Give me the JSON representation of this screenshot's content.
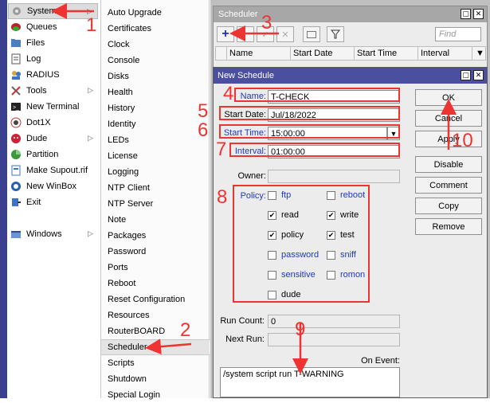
{
  "left_menu": {
    "items": [
      {
        "label": "System",
        "icon": "gear-icon",
        "submenu": true,
        "active": true
      },
      {
        "label": "Queues",
        "icon": "queues-icon",
        "submenu": false
      },
      {
        "label": "Files",
        "icon": "folder-icon",
        "submenu": false
      },
      {
        "label": "Log",
        "icon": "log-icon",
        "submenu": false
      },
      {
        "label": "RADIUS",
        "icon": "users-icon",
        "submenu": false
      },
      {
        "label": "Tools",
        "icon": "tools-icon",
        "submenu": true
      },
      {
        "label": "New Terminal",
        "icon": "terminal-icon",
        "submenu": false
      },
      {
        "label": "Dot1X",
        "icon": "dot1x-icon",
        "submenu": false
      },
      {
        "label": "Dude",
        "icon": "dude-icon",
        "submenu": true
      },
      {
        "label": "Partition",
        "icon": "partition-icon",
        "submenu": false
      },
      {
        "label": "Make Supout.rif",
        "icon": "document-icon",
        "submenu": false
      },
      {
        "label": "New WinBox",
        "icon": "winbox-icon",
        "submenu": false
      },
      {
        "label": "Exit",
        "icon": "exit-icon",
        "submenu": false
      },
      {
        "label": "Windows",
        "icon": "windows-icon",
        "submenu": true
      }
    ]
  },
  "submenu": {
    "items": [
      "Auto Upgrade",
      "Certificates",
      "Clock",
      "Console",
      "Disks",
      "Health",
      "History",
      "Identity",
      "LEDs",
      "License",
      "Logging",
      "NTP Client",
      "NTP Server",
      "Note",
      "Packages",
      "Password",
      "Ports",
      "Reboot",
      "Reset Configuration",
      "Resources",
      "RouterBOARD",
      "Scheduler",
      "Scripts",
      "Shutdown",
      "Special Login"
    ],
    "active": "Scheduler"
  },
  "scheduler": {
    "title": "Scheduler",
    "find_placeholder": "Find",
    "columns": [
      "Name",
      "Start Date",
      "Start Time",
      "Interval"
    ]
  },
  "dialog": {
    "title": "New Schedule",
    "name_label": "Name:",
    "name_value": "T-CHECK",
    "start_date_label": "Start Date:",
    "start_date_value": "Jul/18/2022",
    "start_time_label": "Start Time:",
    "start_time_value": "15:00:00",
    "interval_label": "Interval:",
    "interval_value": "01:00:00",
    "owner_label": "Owner:",
    "policy_label": "Policy:",
    "policies": [
      {
        "label": "ftp",
        "checked": false
      },
      {
        "label": "reboot",
        "checked": false
      },
      {
        "label": "read",
        "checked": true
      },
      {
        "label": "write",
        "checked": true
      },
      {
        "label": "policy",
        "checked": true
      },
      {
        "label": "test",
        "checked": true
      },
      {
        "label": "password",
        "checked": false
      },
      {
        "label": "sniff",
        "checked": false
      },
      {
        "label": "sensitive",
        "checked": false
      },
      {
        "label": "romon",
        "checked": false
      },
      {
        "label": "dude",
        "checked": false
      }
    ],
    "run_count_label": "Run Count:",
    "run_count_value": "0",
    "next_run_label": "Next Run:",
    "on_event_label": "On Event:",
    "on_event_value": "/system script run T-WARNING",
    "buttons": [
      "OK",
      "Cancel",
      "Apply",
      "Disable",
      "Comment",
      "Copy",
      "Remove"
    ]
  },
  "annotations": [
    "1",
    "2",
    "3",
    "4",
    "5",
    "6",
    "7",
    "8",
    "9",
    "10"
  ]
}
